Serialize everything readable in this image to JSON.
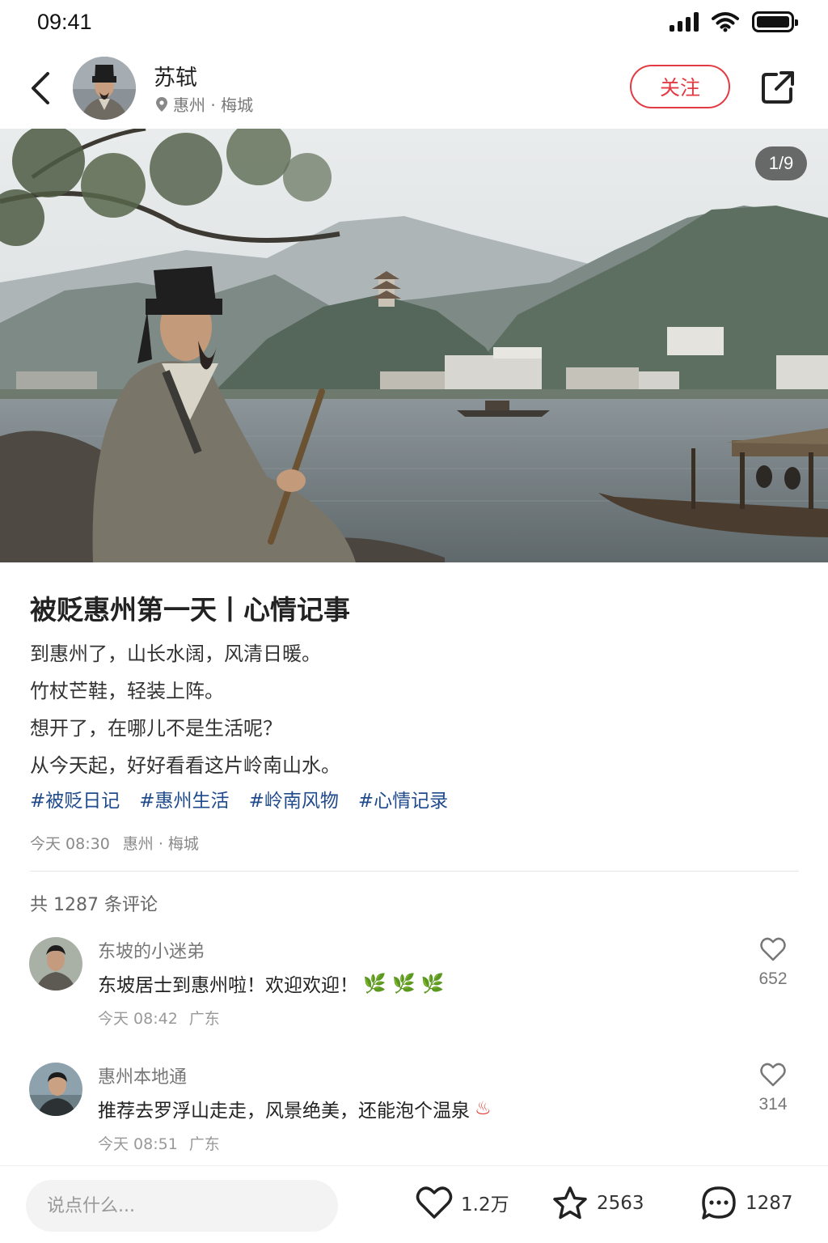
{
  "status_bar": {
    "time": "09:41"
  },
  "header": {
    "author_name": "苏轼",
    "location": "惠州 · 梅城",
    "follow_label": "关注"
  },
  "hero": {
    "counter": "1/9"
  },
  "post": {
    "title": "被贬惠州第一天丨心情记事",
    "lines": [
      "到惠州了，山长水阔，风清日暖。",
      "竹杖芒鞋，轻装上阵。",
      "想开了，在哪儿不是生活呢？",
      "从今天起，好好看看这片岭南山水。"
    ],
    "tags": [
      "#被贬日记",
      "#惠州生活",
      "#岭南风物",
      "#心情记录"
    ],
    "time": "今天 08:30",
    "location": "惠州 · 梅城"
  },
  "comments": {
    "count_label": "共 1287 条评论",
    "items": [
      {
        "name": "东坡的小迷弟",
        "text": "东坡居士到惠州啦！欢迎欢迎！",
        "emoji": "🌿 🌿 🌿",
        "time": "今天 08:42",
        "region": "广东",
        "likes": "652"
      },
      {
        "name": "惠州本地通",
        "text": "推荐去罗浮山走走，风景绝美，还能泡个温泉",
        "emoji": "♨",
        "time": "今天 08:51",
        "region": "广东",
        "likes": "314"
      }
    ]
  },
  "bottom_bar": {
    "input_placeholder": "说点什么...",
    "likes": "1.2万",
    "favorites": "2563",
    "comments": "1287"
  },
  "colors": {
    "accent": "#e33b43",
    "tag": "#1f4a8c"
  },
  "icons": [
    "back-icon",
    "location-pin-icon",
    "share-icon",
    "heart-icon",
    "star-icon",
    "comment-icon",
    "signal-icon",
    "wifi-icon",
    "battery-icon"
  ]
}
